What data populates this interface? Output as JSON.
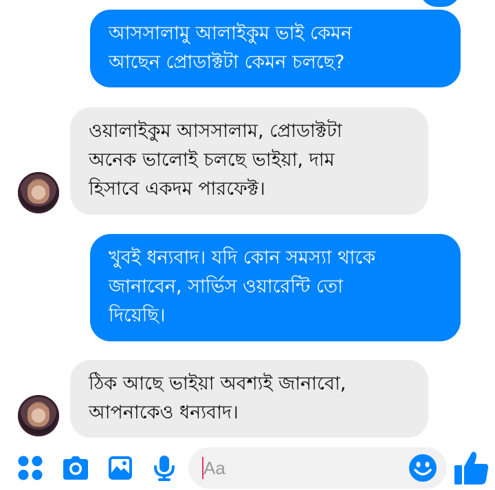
{
  "colors": {
    "accent": "#0084ff",
    "incoming_bubble": "#ececec",
    "outgoing_text": "#ffffff",
    "incoming_text": "#111111"
  },
  "messages": [
    {
      "direction": "outgoing",
      "text": "আসসালামু আলাইকুম ভাই কেমন\nআছেন প্রোডাক্টটা কেমন চলছে?"
    },
    {
      "direction": "incoming",
      "text": "ওয়ালাইকুম আসসালাম, প্রোডাক্টটা\nঅনেক ভালোই চলছে ভাইয়া, দাম\nহিসাবে একদম পারফেক্ট।"
    },
    {
      "direction": "outgoing",
      "text": "খুবই ধন্যবাদ। যদি কোন সমস্যা থাকে\nজানাবেন, সার্ভিস ওয়ারেন্টি তো\nদিয়েছি।"
    },
    {
      "direction": "incoming",
      "text": "ঠিক আছে ভাইয়া অবশ্যই জানাবো,\nআপনাকেও ধন্যবাদ।"
    }
  ],
  "composer": {
    "placeholder": "Aa"
  },
  "toolbar": {
    "icons": [
      "apps-icon",
      "camera-icon",
      "gallery-icon",
      "microphone-icon",
      "emoji-icon",
      "thumbs-up-icon"
    ]
  }
}
